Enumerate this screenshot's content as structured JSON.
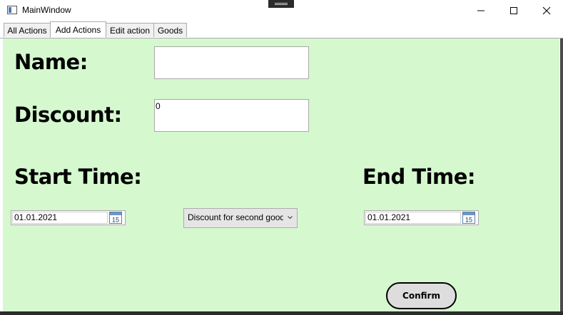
{
  "window": {
    "title": "MainWindow"
  },
  "tabs": [
    {
      "label": "All Actions",
      "selected": false
    },
    {
      "label": "Add Actions",
      "selected": true
    },
    {
      "label": "Edit action",
      "selected": false
    },
    {
      "label": "Goods",
      "selected": false
    }
  ],
  "form": {
    "name_label": "Name:",
    "name_value": "",
    "discount_label": "Discount:",
    "discount_value": "0",
    "start_time_label": "Start Time:",
    "start_date": "01.01.2021",
    "end_time_label": "End Time:",
    "end_date": "01.01.2021",
    "discount_type": "Discount for second goods",
    "confirm_label": "Confirm",
    "calendar_day": "15"
  },
  "colors": {
    "content_background": "#d5f8cf"
  }
}
